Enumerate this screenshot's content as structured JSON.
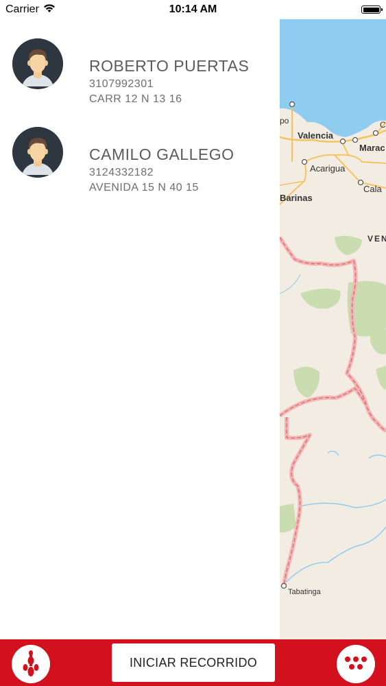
{
  "status_bar": {
    "carrier": "Carrier",
    "time": "10:14 AM"
  },
  "contacts": [
    {
      "name": "ROBERTO PUERTAS",
      "phone": "3107992301",
      "address": "CARR 12 N 13 16"
    },
    {
      "name": "CAMILO GALLEGO",
      "phone": "3124332182",
      "address": "AVENIDA 15 N 40 15"
    }
  ],
  "map": {
    "labels": [
      "po",
      "Valencia",
      "Marac",
      "Acarigua",
      "Cala",
      "Barinas",
      "VEN",
      "Tabatinga",
      "C"
    ]
  },
  "bottom_bar": {
    "start_button_label": "INICIAR RECORRIDO",
    "left_icon": "bowling-pins-icon",
    "right_icon": "bowling-ball-icon"
  },
  "colors": {
    "accent": "#d3111e",
    "map_water": "#8ecdf0",
    "map_land": "#f3ece2",
    "map_green": "#c9ddb0",
    "border_line": "#e88a8a"
  }
}
